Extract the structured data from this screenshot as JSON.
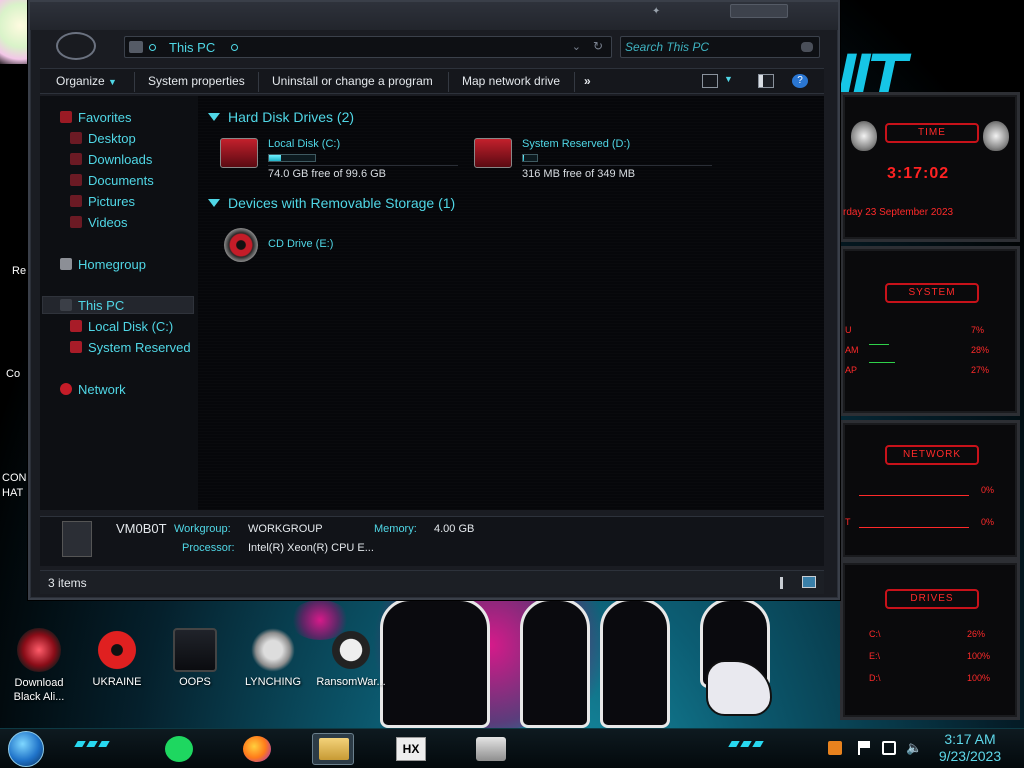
{
  "window": {
    "address": "This PC",
    "search_placeholder": "Search This PC"
  },
  "toolbar": {
    "organize": "Organize",
    "system_properties": "System properties",
    "uninstall": "Uninstall or change a program",
    "map_drive": "Map network drive",
    "more": "»"
  },
  "nav": {
    "favorites": "Favorites",
    "desktop": "Desktop",
    "downloads": "Downloads",
    "documents": "Documents",
    "pictures": "Pictures",
    "videos": "Videos",
    "homegroup": "Homegroup",
    "this_pc": "This PC",
    "local_disk": "Local Disk (C:)",
    "system_reserved": "System Reserved",
    "network": "Network"
  },
  "groups": {
    "hdd": "Hard Disk Drives (2)",
    "removable": "Devices with Removable Storage (1)"
  },
  "drives": [
    {
      "name": "Local Disk (C:)",
      "free": "74.0 GB free of 99.6 GB",
      "used_fraction": 0.26
    },
    {
      "name": "System Reserved (D:)",
      "free": "316 MB free of 349 MB",
      "used_fraction": 0.09
    },
    {
      "name": "CD Drive (E:)"
    }
  ],
  "details": {
    "computer_name": "VM0B0T",
    "workgroup_label": "Workgroup:",
    "workgroup": "WORKGROUP",
    "memory_label": "Memory:",
    "memory": "4.00 GB",
    "processor_label": "Processor:",
    "processor": "Intel(R) Xeon(R) CPU E..."
  },
  "status": {
    "items": "3 items"
  },
  "desktop_icons": [
    {
      "label": "Download\nBlack Ali..."
    },
    {
      "label": "UKRAINE"
    },
    {
      "label": "OOPS"
    },
    {
      "label": "LYNCHING"
    },
    {
      "label": "RansomWar..."
    }
  ],
  "desktop_left_fragments": [
    "Re",
    "Co",
    "CON",
    "HAT"
  ],
  "gadgets": {
    "time_title": "TIME",
    "time_value": "3:17:02",
    "date_value": "rday 23 September 2023",
    "system_title": "SYSTEM",
    "system_rows": [
      {
        "label": "U",
        "value": "7%"
      },
      {
        "label": "AM",
        "value": "28%"
      },
      {
        "label": "AP",
        "value": "27%"
      }
    ],
    "network_title": "NETWORK",
    "network_rows": [
      {
        "label": "",
        "value": "0%"
      },
      {
        "label": "T",
        "value": "0%"
      }
    ],
    "drives_title": "DRIVES",
    "drive_rows": [
      {
        "label": "C:\\",
        "value": "26%"
      },
      {
        "label": "E:\\",
        "value": "100%"
      },
      {
        "label": "D:\\",
        "value": "100%"
      }
    ]
  },
  "clock": {
    "time": "3:17 AM",
    "date": "9/23/2023"
  },
  "colors": {
    "accent": "#50d7e6",
    "gadget_red": "#ff2a2a",
    "panel": "#1a1c22"
  }
}
